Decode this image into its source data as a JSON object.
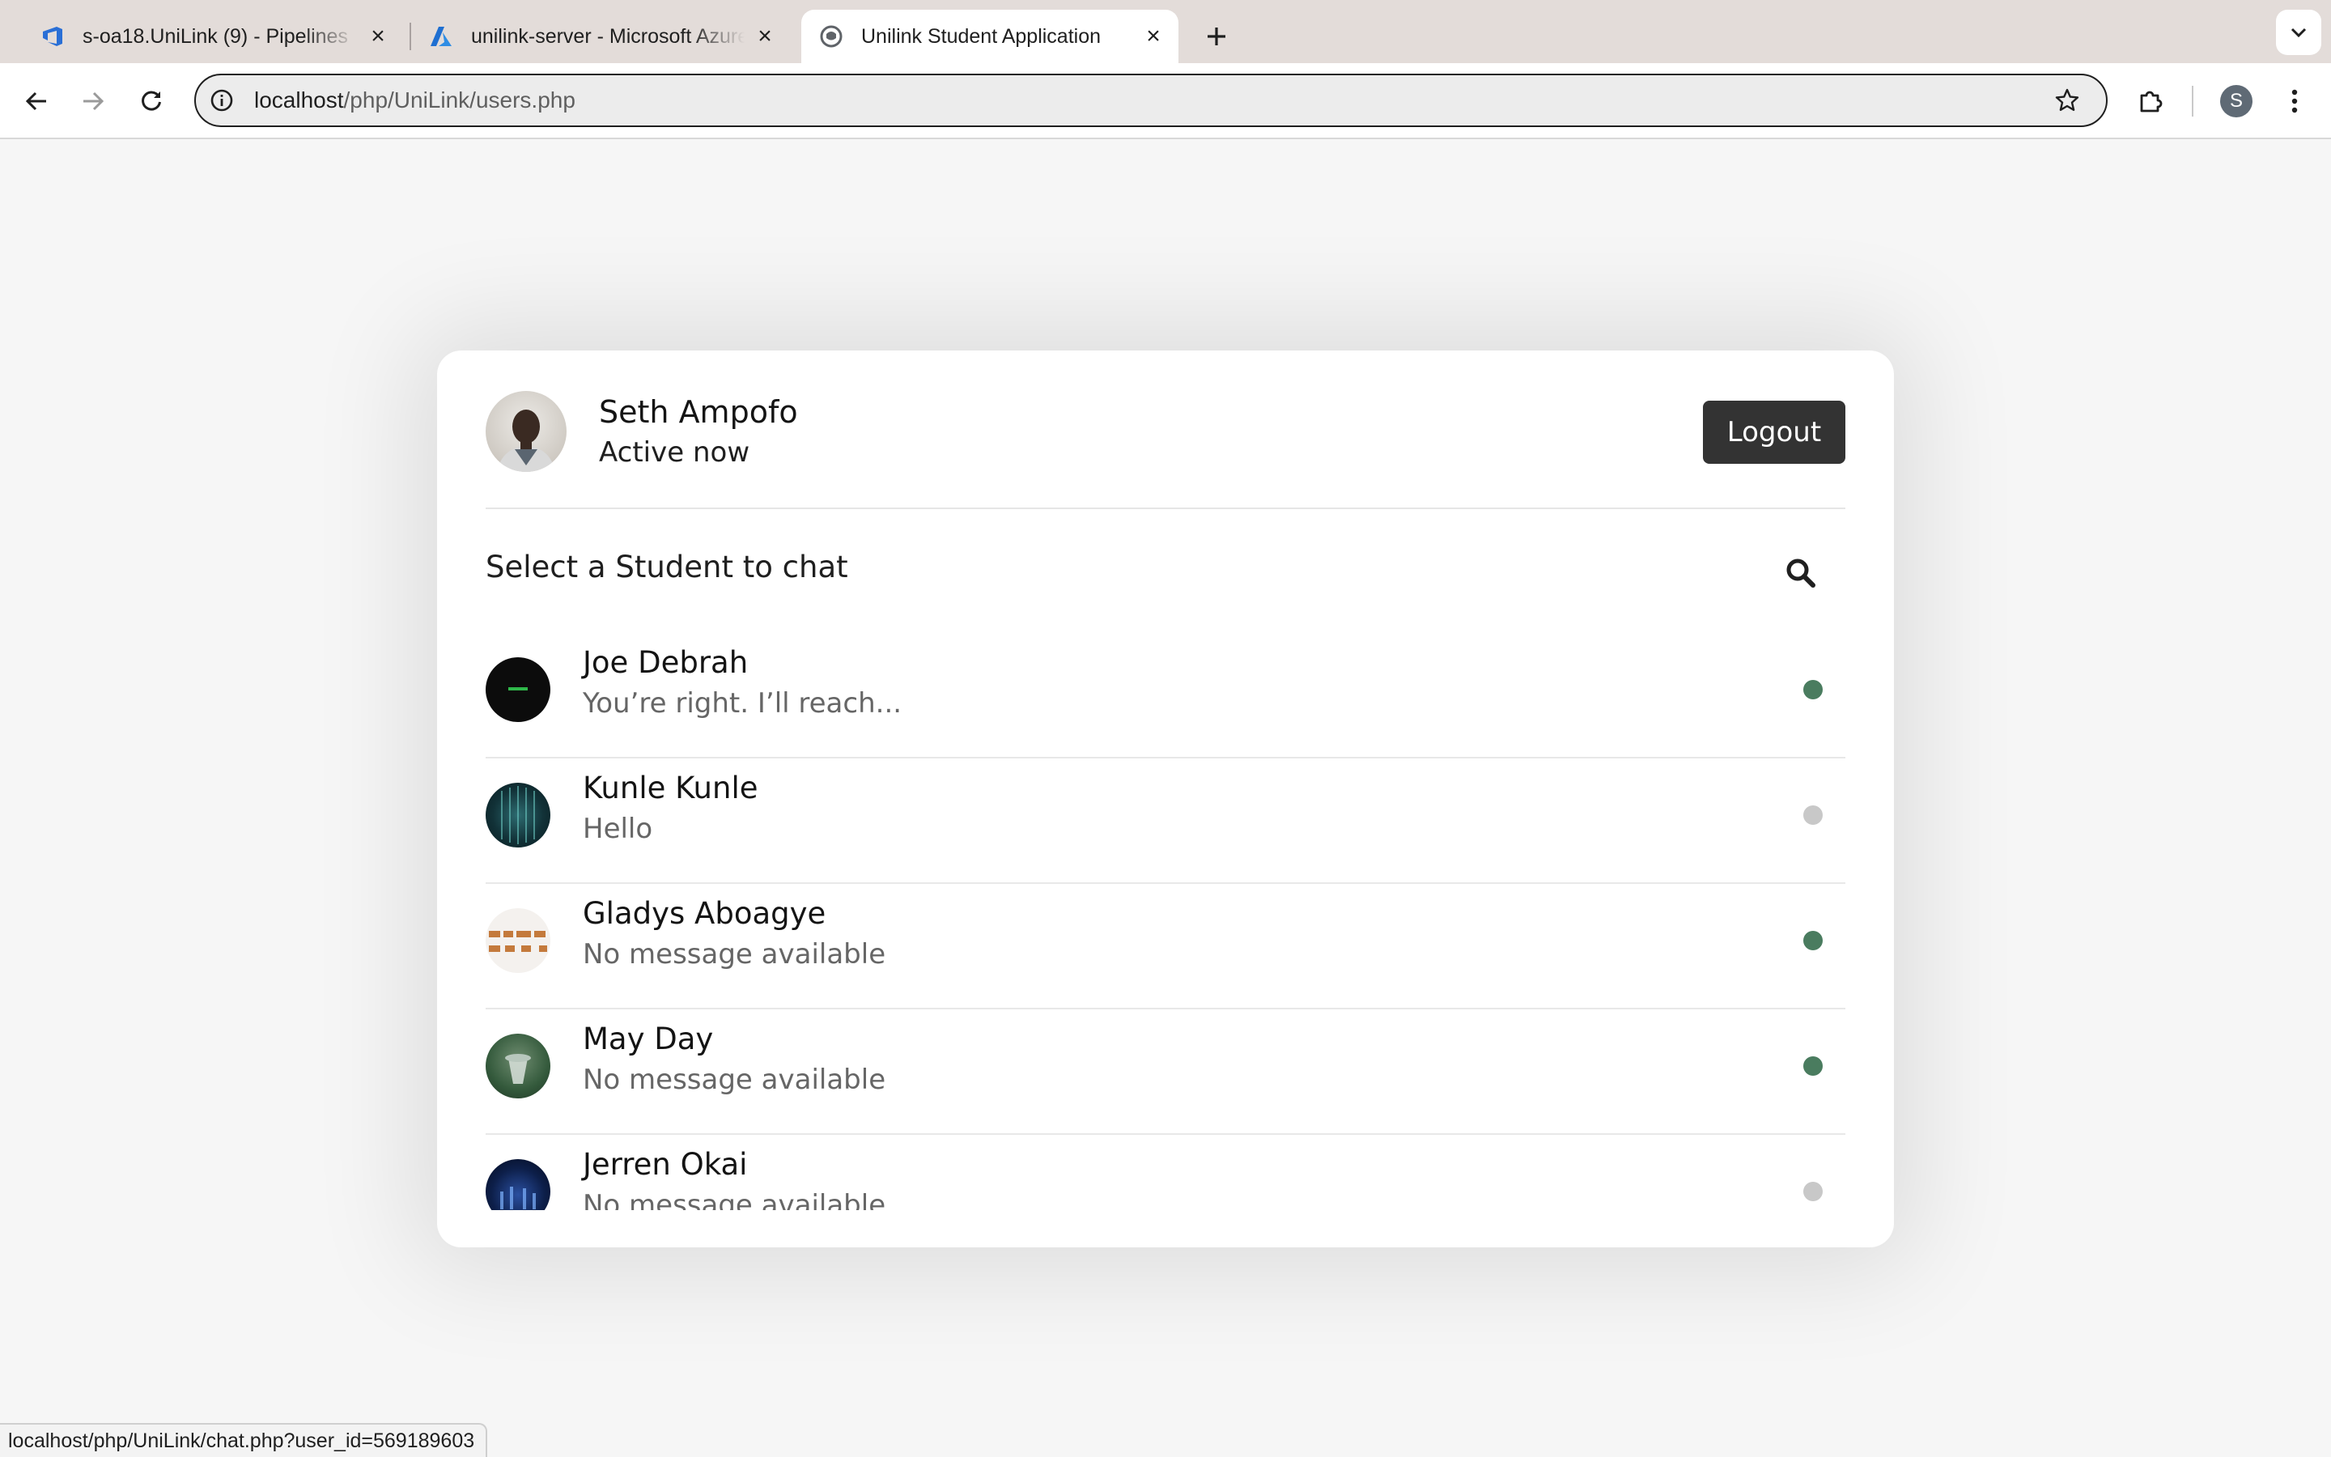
{
  "browser": {
    "tabs": [
      {
        "title": "s-oa18.UniLink (9) - Pipelines",
        "icon": "azure-devops-icon",
        "active": false
      },
      {
        "title": "unilink-server - Microsoft Azure",
        "icon": "azure-icon",
        "active": false
      },
      {
        "title": "Unilink Student Application",
        "icon": "page-globe-icon",
        "active": true
      }
    ],
    "url": {
      "host": "localhost",
      "path": "/php/UniLink/users.php"
    },
    "profile_initial": "S",
    "status_url": "localhost/php/UniLink/chat.php?user_id=569189603"
  },
  "current_user": {
    "name": "Seth Ampofo",
    "status": "Active now"
  },
  "header": {
    "logout_label": "Logout"
  },
  "search": {
    "label": "Select a Student to chat"
  },
  "users": [
    {
      "name": "Joe Debrah",
      "last_message": "You’re right. I’ll reach...",
      "online": true
    },
    {
      "name": "Kunle Kunle",
      "last_message": "Hello",
      "online": false
    },
    {
      "name": "Gladys Aboagye",
      "last_message": "No message available",
      "online": true
    },
    {
      "name": "May Day",
      "last_message": "No message available",
      "online": true
    },
    {
      "name": "Jerren Okai",
      "last_message": "No message available",
      "online": false
    }
  ],
  "colors": {
    "online": "#4a7c5f",
    "offline": "#c8c8c8",
    "logout_bg": "#333333",
    "tabbar_bg": "#e3dcd9"
  }
}
